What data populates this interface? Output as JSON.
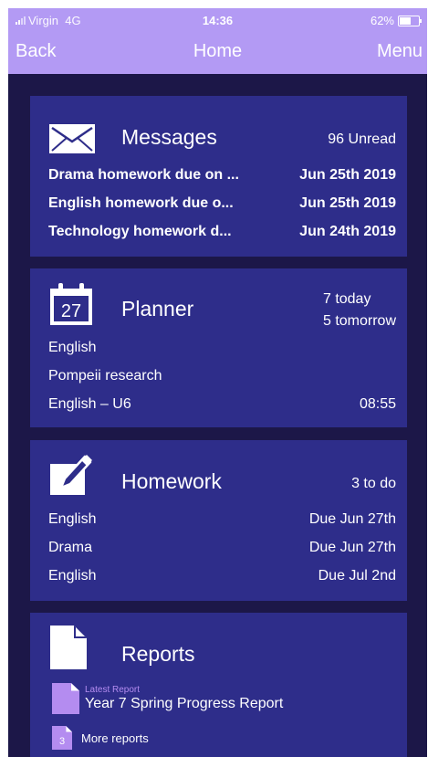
{
  "status_bar": {
    "carrier": "Virgin",
    "network": "4G",
    "time": "14:36",
    "battery": "62%",
    "battery_level": 0.62
  },
  "nav": {
    "back_label": "Back",
    "title": "Home",
    "menu_label": "Menu"
  },
  "colors": {
    "top_bar": "#b39af4",
    "background": "#1c1748",
    "card": "#2e2d8a",
    "accent": "#b48cf0"
  },
  "messages": {
    "title": "Messages",
    "unread": "96 Unread",
    "icon": "envelope-icon",
    "items": [
      {
        "subject": "Drama homework due on ...",
        "date": "Jun 25th 2019"
      },
      {
        "subject": "English homework due o...",
        "date": "Jun 25th 2019"
      },
      {
        "subject": "Technology homework d...",
        "date": "Jun 24th 2019"
      }
    ]
  },
  "planner": {
    "title": "Planner",
    "icon": "calendar-icon",
    "calendar_day": "27",
    "today": "7 today",
    "tomorrow": "5 tomorrow",
    "subject": "English",
    "detail": "Pompeii research",
    "lesson": "English – U6",
    "time": "08:55"
  },
  "homework": {
    "title": "Homework",
    "icon": "pencil-icon",
    "todo": "3 to do",
    "items": [
      {
        "subject": "English",
        "due": "Due Jun 27th"
      },
      {
        "subject": "Drama",
        "due": "Due Jun 27th"
      },
      {
        "subject": "English",
        "due": "Due Jul 2nd"
      }
    ]
  },
  "reports": {
    "title": "Reports",
    "icon": "document-icon",
    "latest_label": "Latest Report",
    "latest_title": "Year 7 Spring Progress Report",
    "more_count": "3",
    "more_label": "More reports"
  }
}
